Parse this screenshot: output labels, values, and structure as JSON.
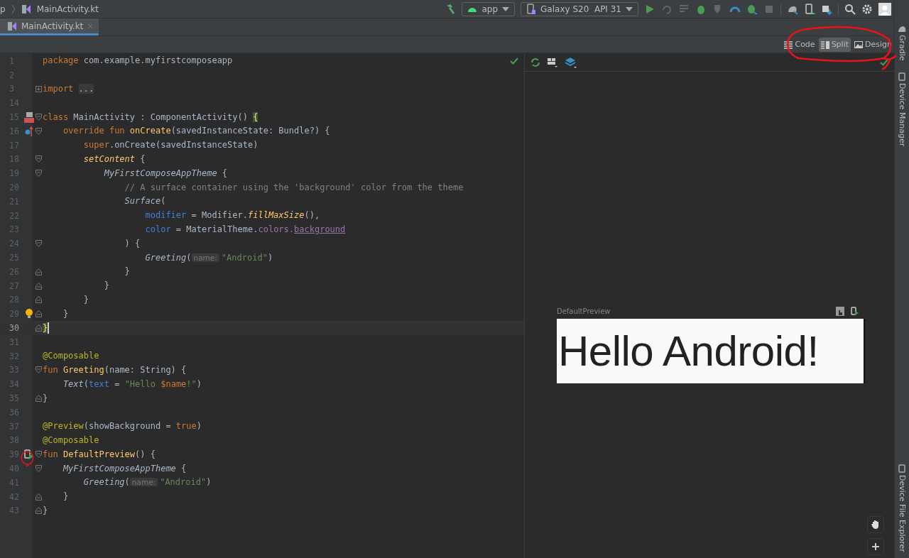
{
  "toolbar": {
    "breadcrumb": [
      "p",
      "MainActivity.kt"
    ],
    "run_config": "app",
    "device": "Galaxy S20  API 31"
  },
  "tabs": [
    {
      "label": "MainActivity.kt",
      "selected": true
    }
  ],
  "view_modes": [
    {
      "kind": "code",
      "label": "Code",
      "selected": false
    },
    {
      "kind": "split",
      "label": "Split",
      "selected": true
    },
    {
      "kind": "design",
      "label": "Design",
      "selected": false
    }
  ],
  "editor": {
    "lines": [
      {
        "number": "1",
        "tokens": [
          {
            "kind": "kw",
            "text": "package "
          },
          {
            "kind": "pl",
            "text": "com.example.myfirstcomposeapp"
          }
        ]
      },
      {
        "number": "2"
      },
      {
        "number": "3",
        "fold": {
          "kind": "collapsed"
        },
        "tokens": [
          {
            "kind": "kw",
            "text": "import "
          },
          {
            "kind": "fold",
            "text": "..."
          }
        ]
      },
      {
        "number": "14"
      },
      {
        "number": "15",
        "gutter": {
          "kind": "class"
        },
        "fold": {
          "kind": "start"
        },
        "tokens": [
          {
            "kind": "kw",
            "text": "class "
          },
          {
            "kind": "pl",
            "text": "MainActivity : ComponentActivity() "
          },
          {
            "kind": "match",
            "text": "{"
          }
        ]
      },
      {
        "number": "16",
        "gutter": {
          "kind": "override"
        },
        "fold": {
          "kind": "start"
        },
        "tokens": [
          {
            "kind": "kw",
            "text": "    override fun "
          },
          {
            "kind": "fn",
            "text": "onCreate"
          },
          {
            "kind": "pl",
            "text": "(savedInstanceState: Bundle?) {"
          }
        ]
      },
      {
        "number": "17",
        "tokens": [
          {
            "kind": "kw",
            "text": "        super"
          },
          {
            "kind": "pl",
            "text": ".onCreate(savedInstanceState)"
          }
        ]
      },
      {
        "number": "18",
        "fold": {
          "kind": "start"
        },
        "tokens": [
          {
            "kind": "ifn",
            "text": "        setContent"
          },
          {
            "kind": "pl",
            "text": " {"
          }
        ]
      },
      {
        "number": "19",
        "fold": {
          "kind": "start"
        },
        "tokens": [
          {
            "kind": "it",
            "text": "            MyFirstComposeAppTheme"
          },
          {
            "kind": "pl",
            "text": " {"
          }
        ]
      },
      {
        "number": "20",
        "tokens": [
          {
            "kind": "cm",
            "text": "                // A surface container using the 'background' color from the theme"
          }
        ]
      },
      {
        "number": "21",
        "tokens": [
          {
            "kind": "it",
            "text": "                Surface"
          },
          {
            "kind": "pl",
            "text": "("
          }
        ]
      },
      {
        "number": "22",
        "tokens": [
          {
            "kind": "arg",
            "text": "                    modifier"
          },
          {
            "kind": "pl",
            "text": " = Modifier."
          },
          {
            "kind": "ifn",
            "text": "fillMaxSize"
          },
          {
            "kind": "pl",
            "text": "(),"
          }
        ]
      },
      {
        "number": "23",
        "tokens": [
          {
            "kind": "arg",
            "text": "                    color"
          },
          {
            "kind": "pl",
            "text": " = MaterialTheme."
          },
          {
            "kind": "prop",
            "text": "colors."
          },
          {
            "kind": "link",
            "text": "background"
          }
        ]
      },
      {
        "number": "24",
        "fold": {
          "kind": "start"
        },
        "tokens": [
          {
            "kind": "pl",
            "text": "                ) {"
          }
        ]
      },
      {
        "number": "25",
        "tokens": [
          {
            "kind": "it",
            "text": "                    Greeting"
          },
          {
            "kind": "pl",
            "text": "("
          },
          {
            "kind": "hint",
            "text": "name:"
          },
          {
            "kind": "str",
            "text": "\"Android\""
          },
          {
            "kind": "pl",
            "text": ")"
          }
        ]
      },
      {
        "number": "26",
        "fold": {
          "kind": "end"
        },
        "tokens": [
          {
            "kind": "pl",
            "text": "                }"
          }
        ]
      },
      {
        "number": "27",
        "fold": {
          "kind": "end"
        },
        "tokens": [
          {
            "kind": "pl",
            "text": "            }"
          }
        ]
      },
      {
        "number": "28",
        "fold": {
          "kind": "end"
        },
        "tokens": [
          {
            "kind": "pl",
            "text": "        }"
          }
        ]
      },
      {
        "number": "29",
        "fold": {
          "kind": "end"
        },
        "gutter": {
          "kind": "bulb"
        },
        "tokens": [
          {
            "kind": "pl",
            "text": "    }"
          }
        ]
      },
      {
        "number": "30",
        "fold": {
          "kind": "end"
        },
        "current": true,
        "tokens": [
          {
            "kind": "match",
            "text": "}"
          }
        ]
      },
      {
        "number": "31"
      },
      {
        "number": "32",
        "tokens": [
          {
            "kind": "ann",
            "text": "@Composable"
          }
        ]
      },
      {
        "number": "33",
        "fold": {
          "kind": "start"
        },
        "tokens": [
          {
            "kind": "kw",
            "text": "fun "
          },
          {
            "kind": "fn",
            "text": "Greeting"
          },
          {
            "kind": "pl",
            "text": "(name: String) {"
          }
        ]
      },
      {
        "number": "34",
        "tokens": [
          {
            "kind": "it",
            "text": "    Text"
          },
          {
            "kind": "pl",
            "text": "("
          },
          {
            "kind": "arg",
            "text": "text"
          },
          {
            "kind": "pl",
            "text": " = "
          },
          {
            "kind": "str",
            "text": "\"Hello "
          },
          {
            "kind": "kw",
            "text": "$name"
          },
          {
            "kind": "str",
            "text": "!\""
          },
          {
            "kind": "pl",
            "text": ")"
          }
        ]
      },
      {
        "number": "35",
        "fold": {
          "kind": "end"
        },
        "tokens": [
          {
            "kind": "pl",
            "text": "}"
          }
        ]
      },
      {
        "number": "36"
      },
      {
        "number": "37",
        "tokens": [
          {
            "kind": "ann",
            "text": "@Preview"
          },
          {
            "kind": "pl",
            "text": "(showBackground = "
          },
          {
            "kind": "kw",
            "text": "true"
          },
          {
            "kind": "pl",
            "text": ")"
          }
        ]
      },
      {
        "number": "38",
        "tokens": [
          {
            "kind": "ann",
            "text": "@Composable"
          }
        ]
      },
      {
        "number": "39",
        "gutter": {
          "kind": "preview"
        },
        "fold": {
          "kind": "start"
        },
        "tokens": [
          {
            "kind": "kw",
            "text": "fun "
          },
          {
            "kind": "fn",
            "text": "DefaultPreview"
          },
          {
            "kind": "pl",
            "text": "() {"
          }
        ]
      },
      {
        "number": "40",
        "fold": {
          "kind": "start"
        },
        "tokens": [
          {
            "kind": "it",
            "text": "    MyFirstComposeAppTheme"
          },
          {
            "kind": "pl",
            "text": " {"
          }
        ]
      },
      {
        "number": "41",
        "tokens": [
          {
            "kind": "it",
            "text": "        Greeting"
          },
          {
            "kind": "pl",
            "text": "("
          },
          {
            "kind": "hint",
            "text": "name:"
          },
          {
            "kind": "str",
            "text": "\"Android\""
          },
          {
            "kind": "pl",
            "text": ")"
          }
        ]
      },
      {
        "number": "42",
        "fold": {
          "kind": "end"
        },
        "tokens": [
          {
            "kind": "pl",
            "text": "    }"
          }
        ]
      },
      {
        "number": "43",
        "fold": {
          "kind": "end"
        },
        "tokens": [
          {
            "kind": "pl",
            "text": "}"
          }
        ]
      }
    ]
  },
  "preview": {
    "title": "DefaultPreview",
    "text": "Hello Android!"
  },
  "side_tools": [
    {
      "kind": "gradle",
      "label": "Gradle"
    },
    {
      "kind": "device",
      "label": "Device Manager"
    },
    {
      "kind": "files",
      "label": "Device File Explorer"
    }
  ]
}
